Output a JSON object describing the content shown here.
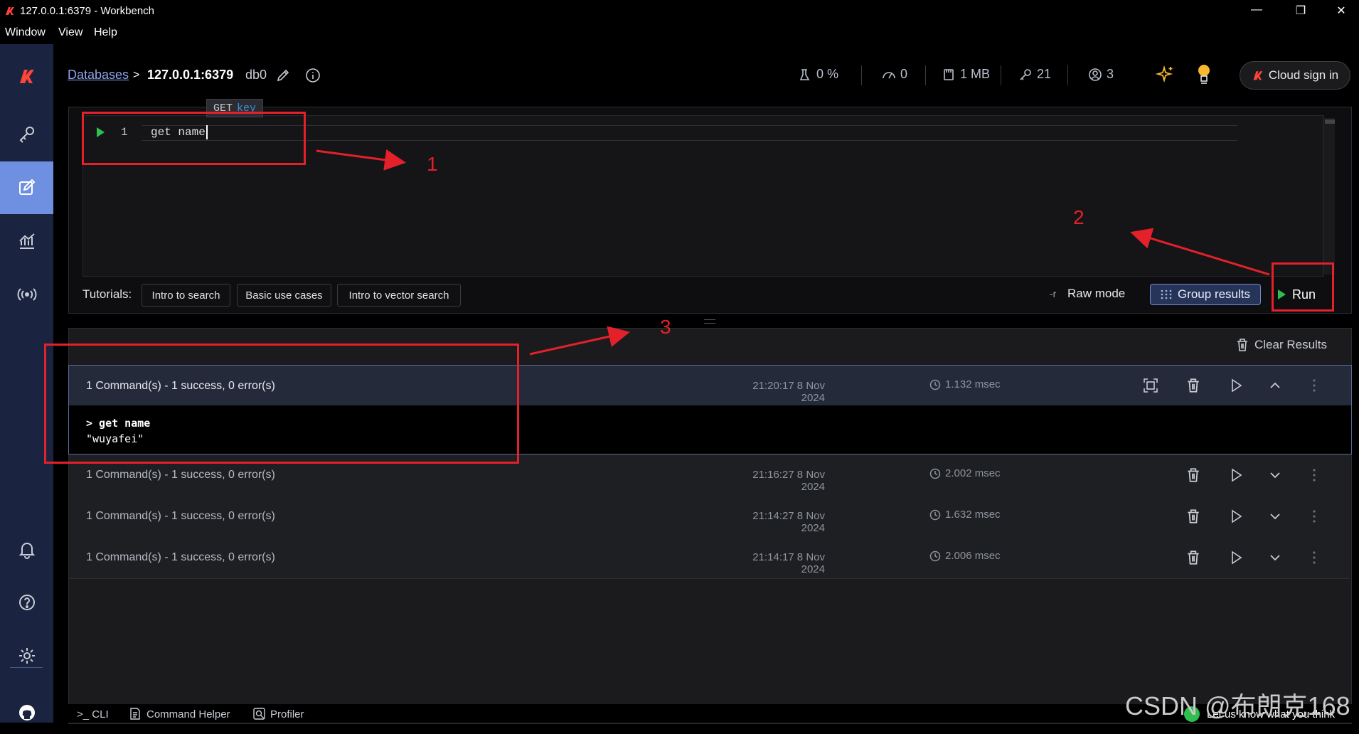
{
  "window": {
    "title": "127.0.0.1:6379 - Workbench",
    "controls": [
      "minimize",
      "restore",
      "close"
    ]
  },
  "menu": [
    "Window",
    "View",
    "Help"
  ],
  "sidebar": {
    "items": [
      {
        "icon": "redis-logo"
      },
      {
        "icon": "key-icon"
      },
      {
        "icon": "workbench-icon",
        "active": true
      },
      {
        "icon": "analytics-icon"
      },
      {
        "icon": "pubsub-icon"
      },
      {
        "icon": "bell-icon"
      },
      {
        "icon": "help-icon"
      },
      {
        "icon": "settings-icon"
      },
      {
        "icon": "github-icon"
      }
    ]
  },
  "header": {
    "breadcrumb_link": "Databases",
    "breadcrumb_sep": ">",
    "db_address": "127.0.0.1:6379",
    "db_index": "db0",
    "stats": {
      "cpu": "0 %",
      "ops": "0",
      "memory": "1 MB",
      "keys": "21",
      "clients": "3"
    },
    "cloud_signin": "Cloud sign in"
  },
  "editor": {
    "line_number": "1",
    "code": "get name",
    "tooltip_cmd": "GET",
    "tooltip_arg": "key",
    "tutorials_label": "Tutorials:",
    "tutorials": [
      "Intro to search",
      "Basic use cases",
      "Intro to vector search"
    ],
    "raw_mode_prefix": "-r",
    "raw_mode": "Raw mode",
    "group_results": "Group results",
    "run": "Run"
  },
  "results": {
    "clear_results": "Clear Results",
    "rows": [
      {
        "summary": "1 Command(s) - 1 success, 0 error(s)",
        "time": "21:20:17 8 Nov 2024",
        "duration": "1.132 msec",
        "expanded": true,
        "command": "> get name",
        "output": "\"wuyafei\""
      },
      {
        "summary": "1 Command(s) - 1 success, 0 error(s)",
        "time": "21:16:27 8 Nov 2024",
        "duration": "2.002 msec",
        "expanded": false
      },
      {
        "summary": "1 Command(s) - 1 success, 0 error(s)",
        "time": "21:14:27 8 Nov 2024",
        "duration": "1.632 msec",
        "expanded": false
      },
      {
        "summary": "1 Command(s) - 1 success, 0 error(s)",
        "time": "21:14:17 8 Nov 2024",
        "duration": "2.006 msec",
        "expanded": false
      }
    ]
  },
  "footer": {
    "cli": ">_ CLI",
    "command_helper": "Command Helper",
    "profiler": "Profiler",
    "feedback": "Let us know what you think"
  },
  "annotations": {
    "labels": [
      "1",
      "2",
      "3"
    ],
    "color": "#e4202a"
  },
  "watermark": "CSDN @布朗克168",
  "colors": {
    "accent": "#6f8fe0",
    "run_green": "#2fbf4f",
    "brand_red": "#e4202a"
  }
}
